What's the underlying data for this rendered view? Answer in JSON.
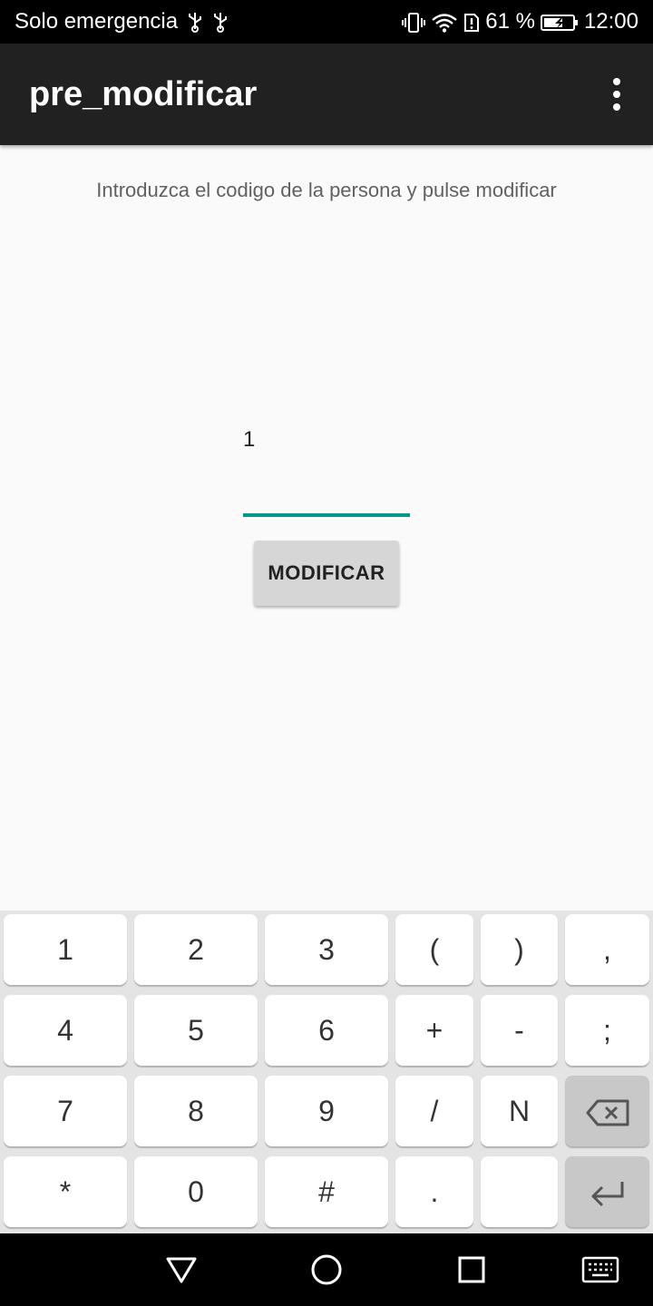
{
  "status_bar": {
    "carrier": "Solo emergencia",
    "battery_percent": "61 %",
    "time": "12:00",
    "icons": [
      "usb-icon",
      "usb-icon",
      "vibrate-icon",
      "wifi-icon",
      "alert-icon",
      "battery-charging-icon"
    ]
  },
  "app_bar": {
    "title": "pre_modificar",
    "overflow_icon": "more-vert-icon"
  },
  "main": {
    "instruction": "Introduzca el codigo de la persona y pulse modificar",
    "code_input_value": "1",
    "modify_button_label": "MODIFICAR",
    "accent_color": "#009688"
  },
  "keyboard": {
    "rows": [
      [
        "1",
        "2",
        "3",
        "(",
        ")",
        ","
      ],
      [
        "4",
        "5",
        "6",
        "+",
        "-",
        ";"
      ],
      [
        "7",
        "8",
        "9",
        "/",
        "N",
        "backspace-icon"
      ],
      [
        "*",
        "0",
        "#",
        ".",
        "",
        "enter-icon"
      ]
    ]
  },
  "nav_bar": {
    "icons": [
      "back-icon",
      "home-icon",
      "recents-icon",
      "keyboard-switch-icon"
    ]
  }
}
